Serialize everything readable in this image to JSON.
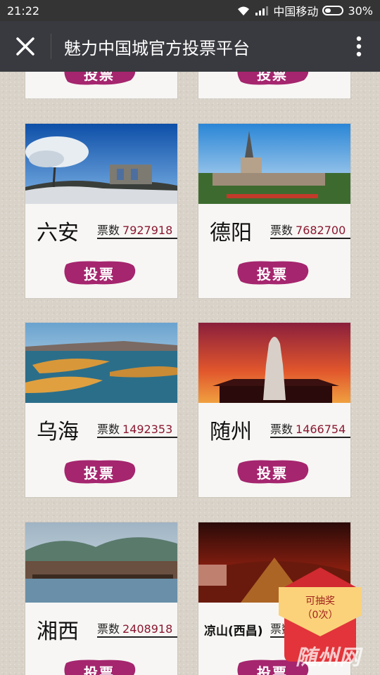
{
  "statusbar": {
    "time": "21:22",
    "carrier": "中国移动",
    "battery": "30%"
  },
  "titlebar": {
    "title": "魅力中国城官方投票平台"
  },
  "vote_label": "票数",
  "vote_button": "投票",
  "cities": [
    {
      "name": "六安",
      "votes": "7927918"
    },
    {
      "name": "德阳",
      "votes": "7682700"
    },
    {
      "name": "乌海",
      "votes": "1492353"
    },
    {
      "name": "随州",
      "votes": "1466754"
    },
    {
      "name": "湘西",
      "votes": "2408918"
    },
    {
      "name": "凉山(西昌)",
      "votes": ""
    }
  ],
  "lottery": {
    "line1": "可抽奖",
    "line2": "（0次）"
  },
  "watermark": "随州网",
  "colors": {
    "vote_button": "#a5256e",
    "number": "#8a1830",
    "bar": "#393a3f"
  }
}
